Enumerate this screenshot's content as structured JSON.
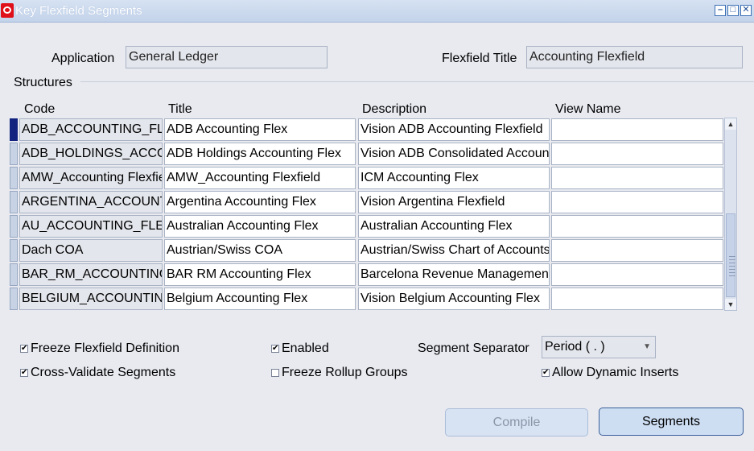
{
  "window": {
    "title": "Key Flexfield Segments",
    "controls": [
      "minimize-icon",
      "maximize-icon",
      "close-icon"
    ]
  },
  "header": {
    "application_label": "Application",
    "application_value": "General Ledger",
    "flexfield_title_label": "Flexfield Title",
    "flexfield_title_value": "Accounting Flexfield"
  },
  "structures": {
    "group_label": "Structures",
    "columns": {
      "code": "Code",
      "title": "Title",
      "description": "Description",
      "view_name": "View Name"
    },
    "rows": [
      {
        "code": "ADB_ACCOUNTING_FLEX",
        "title": "ADB Accounting Flex",
        "description": "Vision ADB Accounting Flexfield",
        "view_name": ""
      },
      {
        "code": "ADB_HOLDINGS_ACCOUNTING_FLEX",
        "title": "ADB Holdings Accounting Flex",
        "description": "Vision ADB Consolidated Accounting Flex",
        "view_name": ""
      },
      {
        "code": "AMW_Accounting Flexfield",
        "title": "AMW_Accounting Flexfield",
        "description": "ICM Accounting Flex",
        "view_name": ""
      },
      {
        "code": "ARGENTINA_ACCOUNTING_FLEX",
        "title": "Argentina Accounting Flex",
        "description": "Vision Argentina Flexfield",
        "view_name": ""
      },
      {
        "code": "AU_ACCOUNTING_FLEX",
        "title": "Australian Accounting Flex",
        "description": "Australian Accounting Flex",
        "view_name": ""
      },
      {
        "code": "Dach COA",
        "title": "Austrian/Swiss COA",
        "description": "Austrian/Swiss Chart of Accounts",
        "view_name": ""
      },
      {
        "code": "BAR_RM_ACCOUNTING_FLEX",
        "title": "BAR RM Accounting Flex",
        "description": "Barcelona Revenue Management",
        "view_name": ""
      },
      {
        "code": "BELGIUM_ACCOUNTING_FLEX",
        "title": "Belgium Accounting Flex",
        "description": "Vision Belgium Accounting Flex",
        "view_name": ""
      }
    ]
  },
  "options": {
    "freeze_definition": {
      "label": "Freeze Flexfield Definition",
      "checked": true
    },
    "cross_validate": {
      "label": "Cross-Validate Segments",
      "checked": true
    },
    "enabled": {
      "label": "Enabled",
      "checked": true
    },
    "freeze_rollup": {
      "label": "Freeze Rollup Groups",
      "checked": false
    },
    "segment_separator_label": "Segment Separator",
    "segment_separator_value": "Period ( . )",
    "allow_dynamic": {
      "label": "Allow Dynamic Inserts",
      "checked": true
    }
  },
  "buttons": {
    "compile": "Compile",
    "segments": "Segments"
  },
  "colors": {
    "current_row_indicator": "#12237f",
    "oracle_red": "#e0101a"
  }
}
